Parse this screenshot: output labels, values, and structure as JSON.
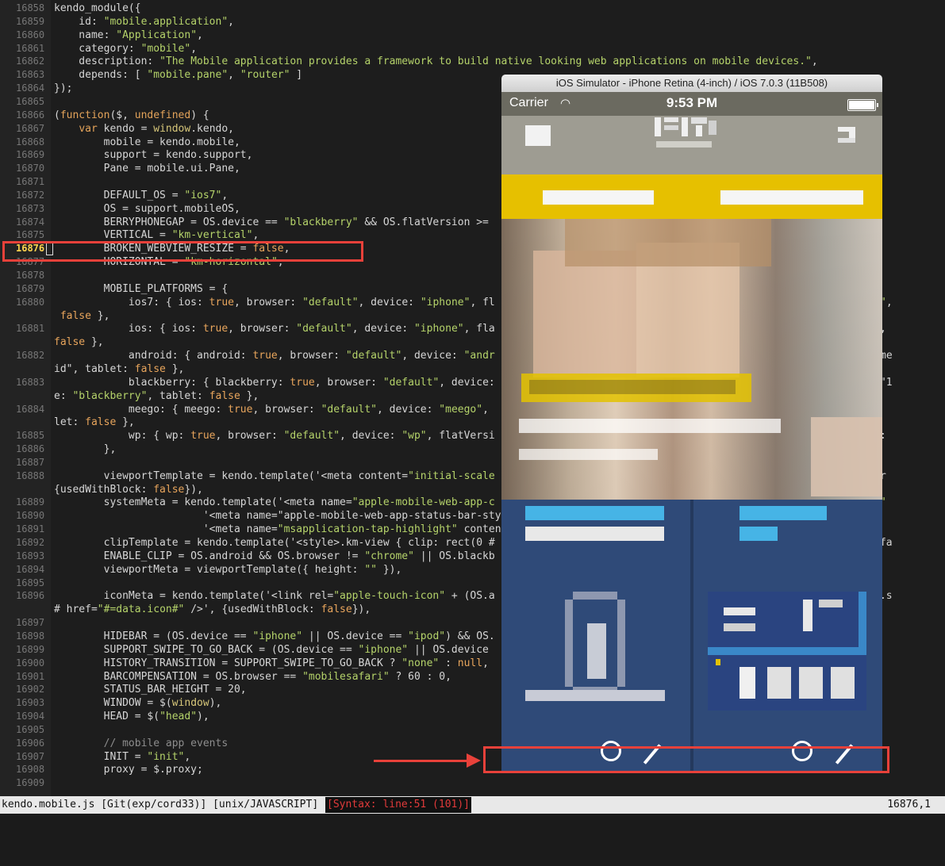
{
  "editor": {
    "lines": [
      {
        "n": "16858",
        "text": "kendo_module({"
      },
      {
        "n": "16859",
        "text": "    id: \"mobile.application\","
      },
      {
        "n": "16860",
        "text": "    name: \"Application\","
      },
      {
        "n": "16861",
        "text": "    category: \"mobile\","
      },
      {
        "n": "16862",
        "text": "    description: \"The Mobile application provides a framework to build native looking web applications on mobile devices.\","
      },
      {
        "n": "16863",
        "text": "    depends: [ \"mobile.pane\", \"router\" ]"
      },
      {
        "n": "16864",
        "text": "});"
      },
      {
        "n": "16865",
        "text": ""
      },
      {
        "n": "16866",
        "text": "(function($, undefined) {"
      },
      {
        "n": "16867",
        "text": "    var kendo = window.kendo,"
      },
      {
        "n": "16868",
        "text": "        mobile = kendo.mobile,"
      },
      {
        "n": "16869",
        "text": "        support = kendo.support,"
      },
      {
        "n": "16870",
        "text": "        Pane = mobile.ui.Pane,"
      },
      {
        "n": "16871",
        "text": ""
      },
      {
        "n": "16872",
        "text": "        DEFAULT_OS = \"ios7\","
      },
      {
        "n": "16873",
        "text": "        OS = support.mobileOS,"
      },
      {
        "n": "16874",
        "text": "        BERRYPHONEGAP = OS.device == \"blackberry\" && OS.flatVersion >="
      },
      {
        "n": "16875",
        "text": "        VERTICAL = \"km-vertical\","
      },
      {
        "n": "16876",
        "text": "        BROKEN_WEBVIEW_RESIZE = false,",
        "current": true
      },
      {
        "n": "16877",
        "text": "        HORIZONTAL = \"km-horizontal\","
      },
      {
        "n": "16878",
        "text": ""
      },
      {
        "n": "16879",
        "text": "        MOBILE_PLATFORMS = {"
      },
      {
        "n": "16880",
        "text": "            ios7: { ios: true, browser: \"default\", device: \"iphone\", fl                                                     ame: \"ios\","
      },
      {
        "n": "",
        "text": " false },"
      },
      {
        "n": "16881",
        "text": "            ios: { ios: true, browser: \"default\", device: \"iphone\", fla                                                     me: \"ios\","
      },
      {
        "n": "",
        "text": "false },"
      },
      {
        "n": "16882",
        "text": "            android: { android: true, browser: \"default\", device: \"andr                                                     73.3\", name"
      },
      {
        "n": "",
        "text": "id\", tablet: false },"
      },
      {
        "n": "16883",
        "text": "            blackberry: { blackberry: true, browser: \"default\", device:                                                     Version: \"1"
      },
      {
        "n": "",
        "text": "e: \"blackberry\", tablet: false },"
      },
      {
        "n": "16884",
        "text": "            meego: { meego: true, browser: \"default\", device: \"meego\",                                                     name: \"mee"
      },
      {
        "n": "",
        "text": "let: false },"
      },
      {
        "n": "16885",
        "text": "            wp: { wp: true, browser: \"default\", device: \"wp\", flatVersi                                                     \", tablet:"
      },
      {
        "n": "16886",
        "text": "        },"
      },
      {
        "n": "16887",
        "text": ""
      },
      {
        "n": "16888",
        "text": "        viewportTemplate = kendo.template('<meta content=\"initial-scale                                                     e=\"viewpor"
      },
      {
        "n": "",
        "text": "{usedWithBlock: false}),"
      },
      {
        "n": "16889",
        "text": "        systemMeta = kendo.template('<meta name=\"apple-mobile-web-app-c                                                     \\'yes\\' #\""
      },
      {
        "n": "16890",
        "text": "                        '<meta name=\"apple-mobile-web-app-status-bar-style"
      },
      {
        "n": "16891",
        "text": "                        '<meta name=\"msapplication-tap-highlight\" content="
      },
      {
        "n": "16892",
        "text": "        clipTemplate = kendo.template('<style>.km-view { clip: rect(0 #                                                     thBlock: fa"
      },
      {
        "n": "16893",
        "text": "        ENABLE_CLIP = OS.android && OS.browser != \"chrome\" || OS.blackb"
      },
      {
        "n": "16894",
        "text": "        viewportMeta = viewportTemplate({ height: \"\" }),"
      },
      {
        "n": "16895",
        "text": ""
      },
      {
        "n": "16896",
        "text": "        iconMeta = kendo.template('<link rel=\"apple-touch-icon\" + (OS.a                                                     s=\"#=data.s"
      },
      {
        "n": "",
        "text": "# href=\"#=data.icon#\" />', {usedWithBlock: false}),"
      },
      {
        "n": "16897",
        "text": ""
      },
      {
        "n": "16898",
        "text": "        HIDEBAR = (OS.device == \"iphone\" || OS.device == \"ipod\") && OS."
      },
      {
        "n": "16899",
        "text": "        SUPPORT_SWIPE_TO_GO_BACK = (OS.device == \"iphone\" || OS.device"
      },
      {
        "n": "16900",
        "text": "        HISTORY_TRANSITION = SUPPORT_SWIPE_TO_GO_BACK ? \"none\" : null,"
      },
      {
        "n": "16901",
        "text": "        BARCOMPENSATION = OS.browser == \"mobilesafari\" ? 60 : 0,"
      },
      {
        "n": "16902",
        "text": "        STATUS_BAR_HEIGHT = 20,"
      },
      {
        "n": "16903",
        "text": "        WINDOW = $(window),"
      },
      {
        "n": "16904",
        "text": "        HEAD = $(\"head\"),"
      },
      {
        "n": "16905",
        "text": ""
      },
      {
        "n": "16906",
        "text": "        // mobile app events"
      },
      {
        "n": "16907",
        "text": "        INIT = \"init\","
      },
      {
        "n": "16908",
        "text": "        proxy = $.proxy;"
      },
      {
        "n": "16909",
        "text": ""
      }
    ]
  },
  "statusbar": {
    "file": "kendo.mobile.js [Git(exp/cord33)] [unix/JAVASCRIPT]",
    "syntax": "[Syntax: line:51 (101)]",
    "position": "16876,1"
  },
  "simulator": {
    "title": "iOS Simulator - iPhone Retina (4-inch) / iOS 7.0.3 (11B508)",
    "carrier": "Carrier",
    "wifi_icon": "wifi-icon",
    "time": "9:53 PM",
    "battery_icon": "battery-icon"
  },
  "colors": {
    "highlight_box": "#e8413a",
    "yellow_bar": "#e6c000",
    "tiles_bg": "#2f4a78",
    "tile_title": "#46b4e6"
  }
}
